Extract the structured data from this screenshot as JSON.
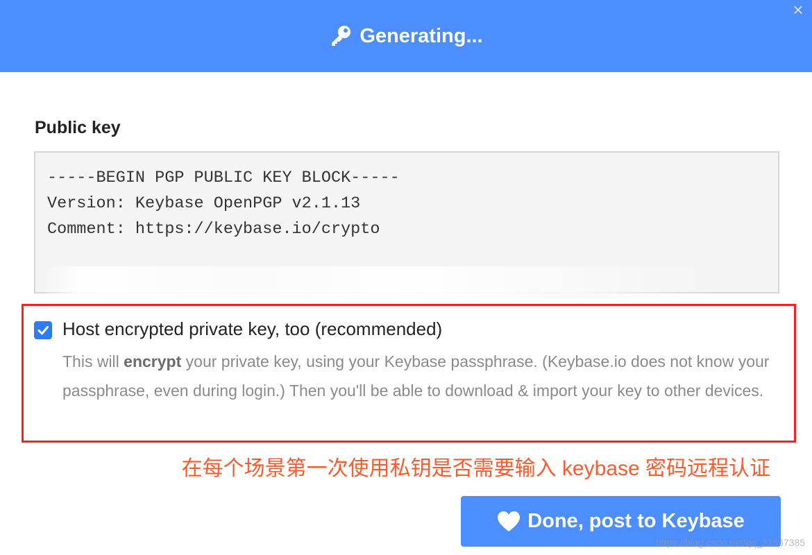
{
  "header": {
    "title": "Generating...",
    "icon": "key-icon",
    "color": "#4c8eff",
    "close_glyph": "×"
  },
  "public_key": {
    "label": "Public key",
    "lines": [
      "-----BEGIN PGP PUBLIC KEY BLOCK-----",
      "Version: Keybase OpenPGP v2.1.13",
      "Comment: https://keybase.io/crypto"
    ]
  },
  "host_option": {
    "checked": true,
    "label": "Host encrypted private key, too (recommended)",
    "help_before": "This will ",
    "help_bold": "encrypt",
    "help_after": " your private key, using your Keybase passphrase. (Keybase.io does not know your passphrase, even during login.) Then you'll be able to download & import your key to other devices."
  },
  "annotation": {
    "text": "在每个场景第一次使用私钥是否需要输入 keybase 密码远程认证",
    "color": "#ff5a2c",
    "frame_color": "#ff1f1f"
  },
  "done_button": {
    "label": "Done, post to Keybase",
    "icon": "heart-icon"
  },
  "watermark": {
    "text": "https://blog.csdn.net/qq_21567385"
  }
}
